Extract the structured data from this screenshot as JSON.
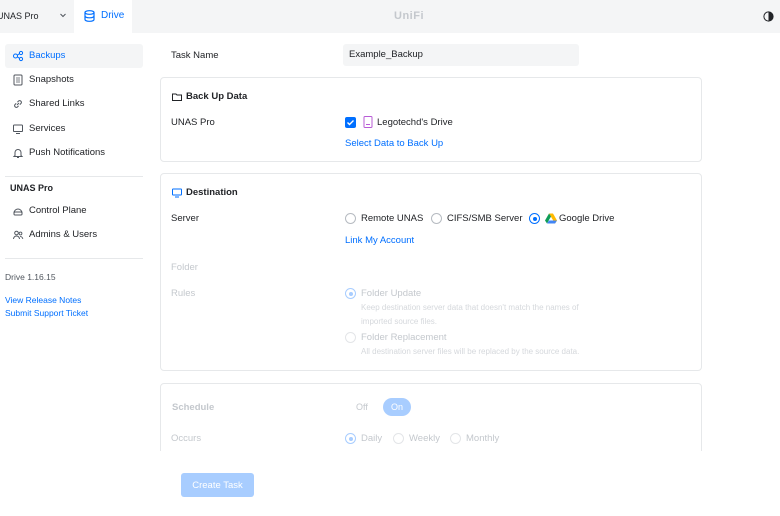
{
  "topbar": {
    "device": "UNAS Pro",
    "app_tab": "Drive",
    "brand": "UniFi"
  },
  "sidebar": {
    "items": [
      {
        "label": "Backups",
        "icon": "backup-icon",
        "active": true
      },
      {
        "label": "Snapshots",
        "icon": "snapshot-icon"
      },
      {
        "label": "Shared Links",
        "icon": "link-icon"
      },
      {
        "label": "Services",
        "icon": "monitor-icon"
      },
      {
        "label": "Push Notifications",
        "icon": "bell-icon"
      }
    ],
    "section_title": "UNAS Pro",
    "section_items": [
      {
        "label": "Control Plane",
        "icon": "control-plane-icon"
      },
      {
        "label": "Admins & Users",
        "icon": "users-icon"
      }
    ],
    "version": "Drive 1.16.15",
    "links": [
      "View Release Notes",
      "Submit Support Ticket"
    ]
  },
  "form": {
    "task_name_label": "Task Name",
    "task_name_value": "Example_Backup",
    "backup_data": {
      "title": "Back Up Data",
      "source_label": "UNAS Pro",
      "source_item": "Legotechd's Drive",
      "select_link": "Select Data to Back Up"
    },
    "destination": {
      "title": "Destination",
      "server_label": "Server",
      "options": [
        "Remote UNAS",
        "CIFS/SMB Server",
        "Google Drive"
      ],
      "selected": "Google Drive",
      "link_account": "Link My Account",
      "folder_label": "Folder",
      "rules_label": "Rules",
      "rule_update": "Folder Update",
      "rule_update_desc": "Keep destination server data that doesn't match the names of imported source files.",
      "rule_replace": "Folder Replacement",
      "rule_replace_desc": "All destination server files will be replaced by the source data."
    },
    "schedule": {
      "title": "Schedule",
      "off": "Off",
      "on": "On",
      "occurs_label": "Occurs",
      "occurs_options": [
        "Daily",
        "Weekly",
        "Monthly"
      ]
    },
    "create_button": "Create Task"
  },
  "colors": {
    "accent": "#006fff",
    "accent_disabled": "#a8cdff",
    "sidebar_active_bg": "#f4f5f6"
  }
}
